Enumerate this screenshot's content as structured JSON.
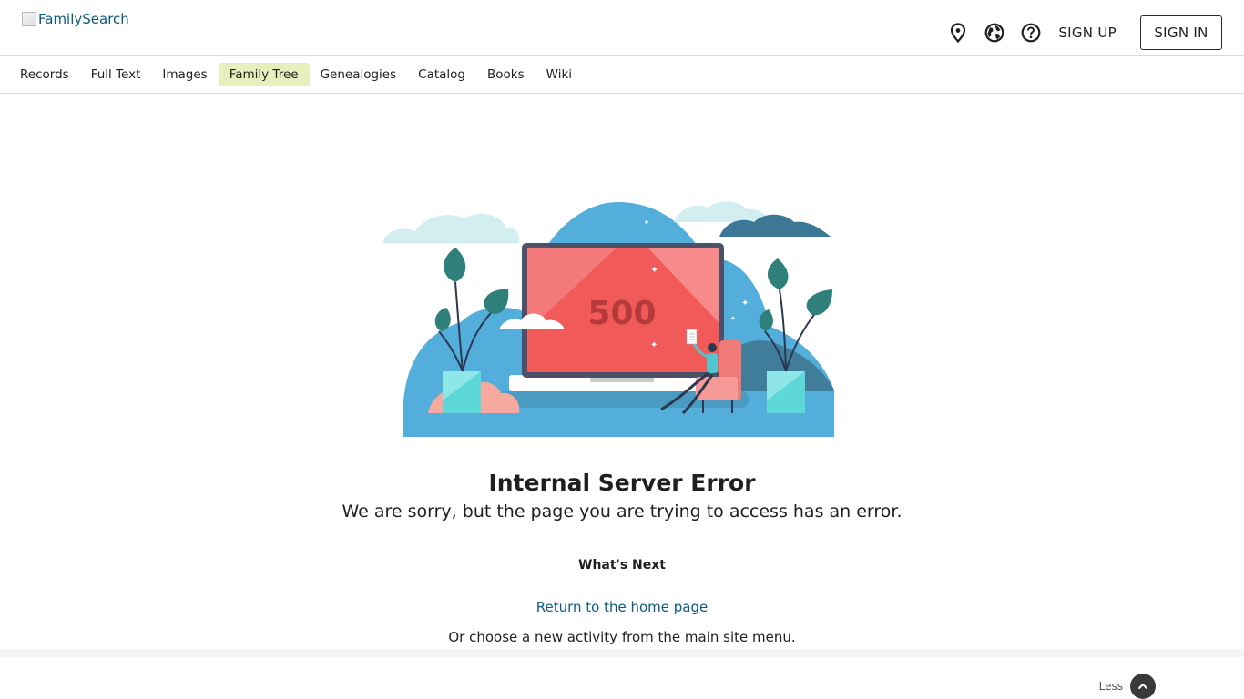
{
  "header": {
    "logo_alt": "FamilySearch",
    "icons": [
      "location-pin-icon",
      "globe-icon",
      "help-icon"
    ],
    "sign_up": "SIGN UP",
    "sign_in": "SIGN IN"
  },
  "nav": {
    "items": [
      {
        "label": "Records",
        "active": false
      },
      {
        "label": "Full Text",
        "active": false
      },
      {
        "label": "Images",
        "active": false
      },
      {
        "label": "Family Tree",
        "active": true
      },
      {
        "label": "Genealogies",
        "active": false
      },
      {
        "label": "Catalog",
        "active": false
      },
      {
        "label": "Books",
        "active": false
      },
      {
        "label": "Wiki",
        "active": false
      }
    ],
    "active_color": "#e8efbe"
  },
  "illustration": {
    "code": "500"
  },
  "error": {
    "title": "Internal Server Error",
    "message": "We are sorry, but the page you are trying to access has an error.",
    "whats_next": "What's Next",
    "home_link": "Return to the home page",
    "or_choose": "Or choose a new activity from the main site menu."
  },
  "footer": {
    "less_label": "Less"
  },
  "colors": {
    "link": "#0b5b80",
    "screen": "#f25a5a",
    "bubble": "#54aedb",
    "leaf": "#2f7f7a"
  }
}
